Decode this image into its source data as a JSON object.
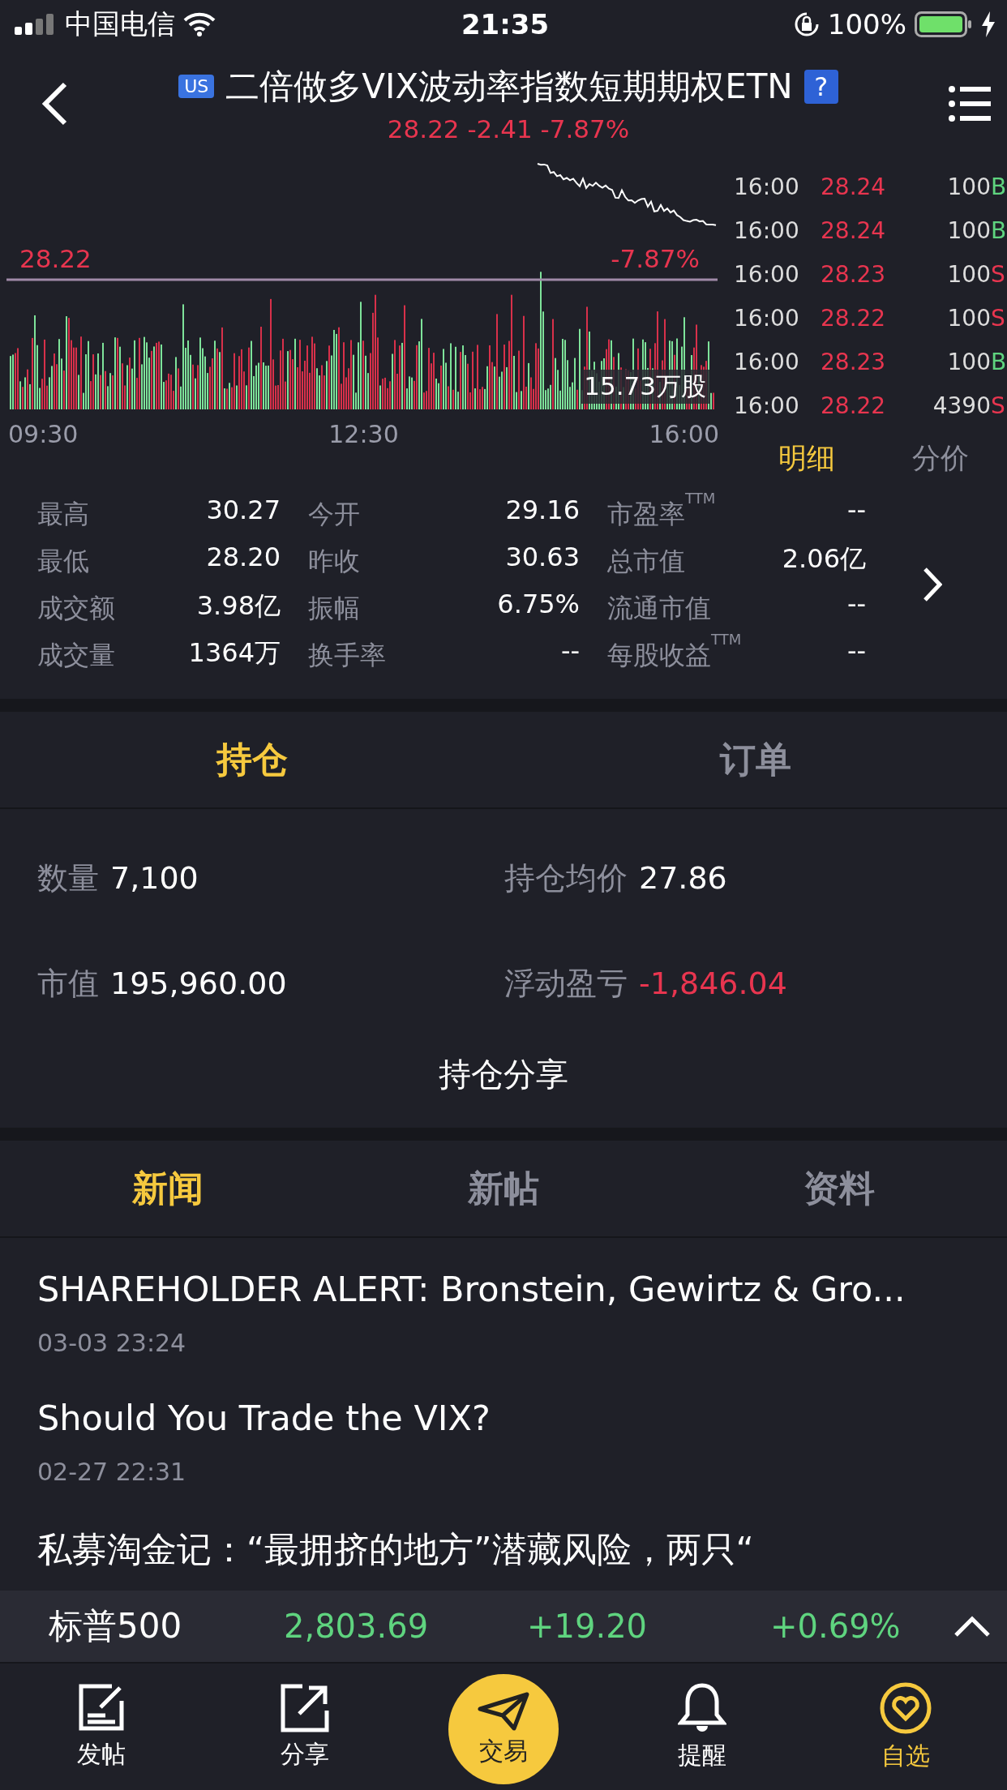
{
  "status_bar": {
    "carrier": "中国电信",
    "time": "21:35",
    "battery": "100%"
  },
  "header": {
    "badge": "US",
    "title": "二倍做多VIX波动率指数短期期权ETN",
    "help": "?",
    "quote": "28.22 -2.41 -7.87%"
  },
  "chart": {
    "price_label": "28.22",
    "change_label": "-7.87%",
    "volume_label": "15.73万股",
    "time_labels": [
      "09:30",
      "12:30",
      "16:00"
    ]
  },
  "trades": [
    {
      "time": "16:00",
      "price": "28.24",
      "volume": "100",
      "side": "B",
      "color": "#5fd47f"
    },
    {
      "time": "16:00",
      "price": "28.24",
      "volume": "100",
      "side": "B",
      "color": "#5fd47f"
    },
    {
      "time": "16:00",
      "price": "28.23",
      "volume": "100",
      "side": "S",
      "color": "#e8354f"
    },
    {
      "time": "16:00",
      "price": "28.22",
      "volume": "100",
      "side": "S",
      "color": "#e8354f"
    },
    {
      "time": "16:00",
      "price": "28.23",
      "volume": "100",
      "side": "B",
      "color": "#5fd47f"
    },
    {
      "time": "16:00",
      "price": "28.22",
      "volume": "4390",
      "side": "S",
      "color": "#e8354f"
    }
  ],
  "detail_tabs": [
    {
      "label": "明细",
      "selected": true
    },
    {
      "label": "分价",
      "selected": false
    }
  ],
  "stats": [
    {
      "label": "最高",
      "value": "30.27"
    },
    {
      "label": "今开",
      "value": "29.16"
    },
    {
      "label": "市盈率$^{TTM}$",
      "value": "--"
    },
    {
      "label": "最低",
      "value": "28.20"
    },
    {
      "label": "昨收",
      "value": "30.63"
    },
    {
      "label": "总市值",
      "value": "2.06亿"
    },
    {
      "label": "成交额",
      "value": "3.98亿"
    },
    {
      "label": "振幅",
      "value": "6.75%"
    },
    {
      "label": "流通市值",
      "value": "--"
    },
    {
      "label": "成交量",
      "value": "1364万"
    },
    {
      "label": "换手率",
      "value": "--"
    },
    {
      "label": "每股收益$^{TTM}$",
      "value": "--"
    }
  ],
  "position_tabs": [
    {
      "label": "持仓",
      "selected": true
    },
    {
      "label": "订单",
      "selected": false
    }
  ],
  "position_fields": [
    {
      "label": "数量",
      "value": "7,100",
      "color": "#ffffff"
    },
    {
      "label": "持仓均价",
      "value": "27.86",
      "color": "#ffffff"
    },
    {
      "label": "市值",
      "value": "195,960.00",
      "color": "#ffffff"
    },
    {
      "label": "浮动盈亏",
      "value": "-1,846.04",
      "color": "#e8354f"
    }
  ],
  "share_button": "持仓分享",
  "news_tabs": [
    {
      "label": "新闻",
      "selected": true
    },
    {
      "label": "新帖",
      "selected": false
    },
    {
      "label": "资料",
      "selected": false
    }
  ],
  "news": [
    {
      "title": "SHAREHOLDER ALERT: Bronstein, Gewirtz & Gro...",
      "date": "03-03 23:24"
    },
    {
      "title": "Should You Trade the VIX?",
      "date": "02-27 22:31"
    },
    {
      "title": "私募淘金记：“最拥挤的地方”潜藏风险，两只“"
    }
  ],
  "index_bar": {
    "name": "标普500",
    "value": "2,803.69",
    "change": "+19.20",
    "percent": "+0.69%",
    "color": "#5fd47f"
  },
  "tab_bar": [
    {
      "label": "发帖",
      "kind": "post",
      "selected": false
    },
    {
      "label": "分享",
      "kind": "share",
      "selected": false
    },
    {
      "label": "交易",
      "kind": "trade",
      "selected": false
    },
    {
      "label": "提醒",
      "kind": "alert",
      "selected": false
    },
    {
      "label": "自选",
      "kind": "watchlist",
      "selected": true
    }
  ]
}
